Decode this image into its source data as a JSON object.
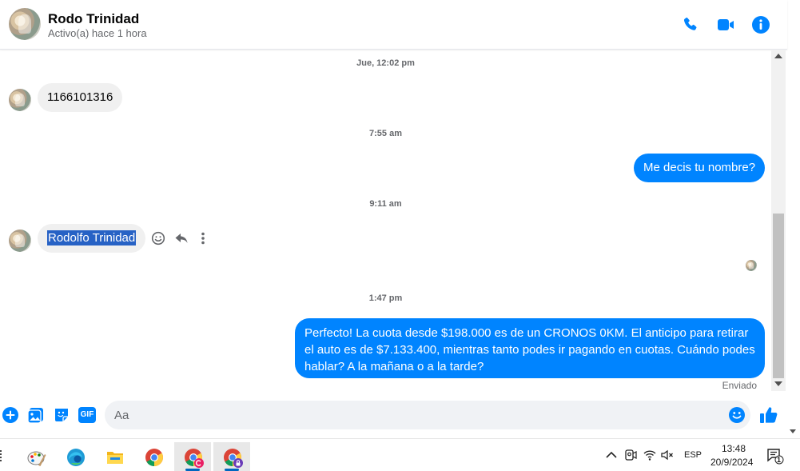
{
  "header": {
    "name": "Rodo Trinidad",
    "status": "Activo(a) hace 1 hora",
    "colors": {
      "accent": "#0084ff"
    },
    "icons": [
      "phone-icon",
      "video-icon",
      "info-icon"
    ]
  },
  "messages": {
    "ts1": "Jue, 12:02 pm",
    "in1": "1166101316",
    "ts2": "7:55 am",
    "out1": "Me decis tu nombre?",
    "ts3": "9:11 am",
    "in2": "Rodolfo Trinidad",
    "ts4": "1:47 pm",
    "out2": "Perfecto! La cuota desde $198.000 es de un CRONOS 0KM. El anticipo para retirar el auto es de $7.133.400, mientras tanto podes ir pagando en cuotas. Cuándo podes hablar? A la mañana o a la tarde?",
    "sent": "Enviado"
  },
  "composer": {
    "placeholder": "Aa",
    "gif_label": "GIF",
    "icons": [
      "add-icon",
      "photo-icon",
      "sticker-icon",
      "gif-icon",
      "emoji-icon",
      "like-icon"
    ]
  },
  "taskbar": {
    "apps": [
      "paint-icon",
      "edge-icon",
      "file-explorer-icon",
      "chrome-icon",
      "chrome-profile-c-icon",
      "chrome-profile-lock-icon"
    ],
    "language": "ESP",
    "time": "13:48",
    "date": "20/9/2024",
    "notification_count": "1"
  }
}
